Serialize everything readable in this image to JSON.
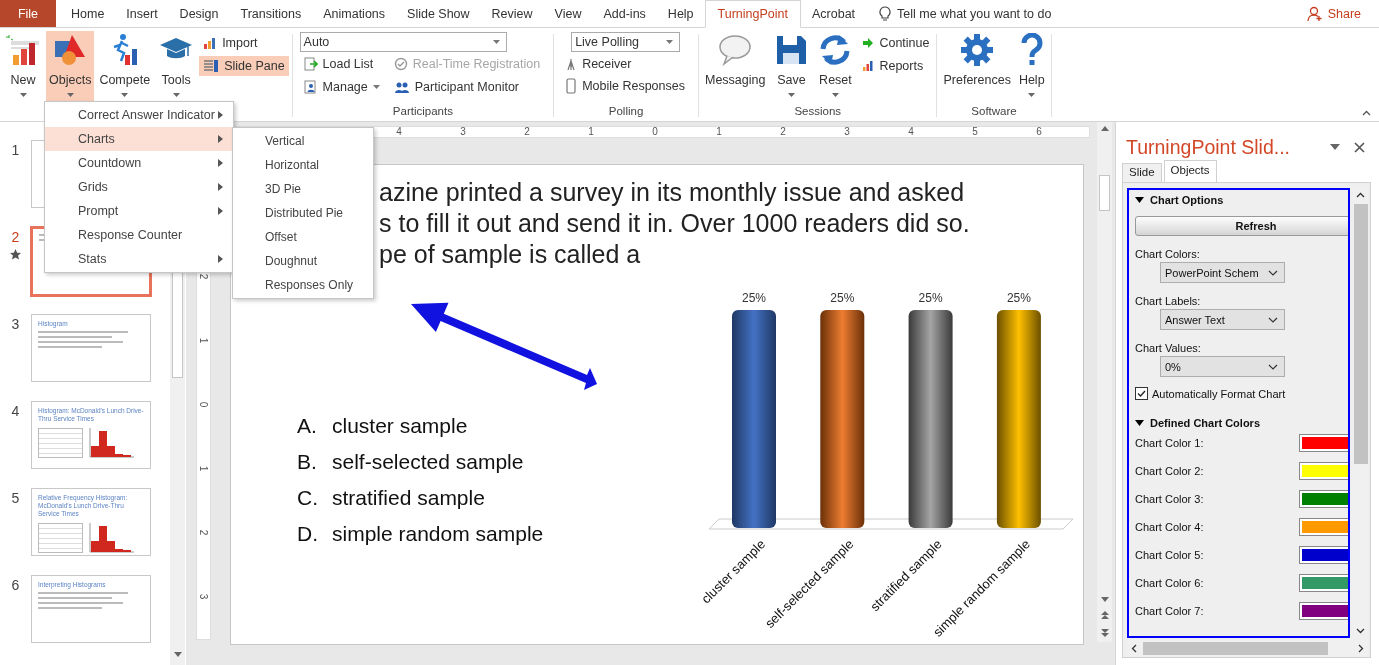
{
  "tabs": [
    {
      "label": "File",
      "kind": "file",
      "selected": false
    },
    {
      "label": "Home",
      "kind": "tab",
      "selected": false
    },
    {
      "label": "Insert",
      "kind": "tab",
      "selected": false
    },
    {
      "label": "Design",
      "kind": "tab",
      "selected": false
    },
    {
      "label": "Transitions",
      "kind": "tab",
      "selected": false
    },
    {
      "label": "Animations",
      "kind": "tab",
      "selected": false
    },
    {
      "label": "Slide Show",
      "kind": "tab",
      "selected": false
    },
    {
      "label": "Review",
      "kind": "tab",
      "selected": false
    },
    {
      "label": "View",
      "kind": "tab",
      "selected": false
    },
    {
      "label": "Add-ins",
      "kind": "tab",
      "selected": false
    },
    {
      "label": "Help",
      "kind": "tab",
      "selected": false
    },
    {
      "label": "TurningPoint",
      "kind": "tab",
      "selected": true
    },
    {
      "label": "Acrobat",
      "kind": "tab",
      "selected": false
    }
  ],
  "tell_me": "Tell me what you want to do",
  "share": "Share",
  "ribbon": {
    "insert_group": {
      "large": [
        {
          "label": "New",
          "caret": true,
          "highlighted": false
        },
        {
          "label": "Objects",
          "caret": true,
          "highlighted": true
        },
        {
          "label": "Compete",
          "caret": true,
          "highlighted": false
        },
        {
          "label": "Tools",
          "caret": true,
          "highlighted": false
        }
      ],
      "small": [
        {
          "label": "Import",
          "highlighted": false
        },
        {
          "label": "Slide Pane",
          "highlighted": true
        }
      ]
    },
    "participants": {
      "label": "Participants",
      "dropdown": "Auto",
      "items": [
        {
          "label": "Load List",
          "disabled": false
        },
        {
          "label": "Real-Time Registration",
          "disabled": true
        },
        {
          "label": "Manage",
          "disabled": false,
          "caret": true
        },
        {
          "label": "Participant Monitor",
          "disabled": false
        }
      ]
    },
    "polling": {
      "label": "Polling",
      "dropdown": "Live Polling",
      "items": [
        {
          "label": "Receiver"
        },
        {
          "label": "Mobile Responses"
        }
      ]
    },
    "sessions": {
      "label": "Sessions",
      "large": [
        {
          "label": "Messaging",
          "caret": false
        },
        {
          "label": "Save",
          "caret": true
        },
        {
          "label": "Reset",
          "caret": true
        }
      ],
      "small": [
        {
          "label": "Continue"
        },
        {
          "label": "Reports"
        }
      ]
    },
    "software": {
      "label": "Software",
      "large": [
        {
          "label": "Preferences",
          "caret": false
        },
        {
          "label": "Help",
          "caret": true
        }
      ]
    }
  },
  "objects_menu": [
    {
      "label": "Correct Answer Indicator",
      "submenu": true,
      "selected": false
    },
    {
      "label": "Charts",
      "submenu": true,
      "selected": true
    },
    {
      "label": "Countdown",
      "submenu": true,
      "selected": false
    },
    {
      "label": "Grids",
      "submenu": true,
      "selected": false
    },
    {
      "label": "Prompt",
      "submenu": true,
      "selected": false
    },
    {
      "label": "Response Counter",
      "submenu": false,
      "selected": false
    },
    {
      "label": "Stats",
      "submenu": true,
      "selected": false
    }
  ],
  "charts_submenu": [
    "Vertical",
    "Horizontal",
    "3D Pie",
    "Distributed Pie",
    "Offset",
    "Doughnut",
    "Responses Only"
  ],
  "slides": [
    {
      "number": "1",
      "kind": "blank",
      "selected": false,
      "starred": false
    },
    {
      "number": "2",
      "kind": "question",
      "selected": true,
      "starred": true
    },
    {
      "number": "3",
      "kind": "bullets",
      "selected": false,
      "starred": false,
      "title": "Histogram"
    },
    {
      "number": "4",
      "kind": "histogram",
      "selected": false,
      "starred": false,
      "title": "Histogram: McDonald's Lunch Drive-Thru Service Times"
    },
    {
      "number": "5",
      "kind": "histogram",
      "selected": false,
      "starred": false,
      "title": "Relative Frequency Histogram: McDonald's Lunch Drive-Thru Service Times"
    },
    {
      "number": "6",
      "kind": "bullets",
      "selected": false,
      "starred": false,
      "title": "Interpreting Histograms"
    }
  ],
  "ruler": {
    "horizontal": [
      "4",
      "3",
      "2",
      "1",
      "0",
      "1",
      "2",
      "3",
      "4",
      "5",
      "6"
    ],
    "vertical": [
      "2",
      "1",
      "0",
      "1",
      "2",
      "3"
    ]
  },
  "slide": {
    "question_lines": [
      "azine printed a survey in its monthly issue and asked",
      "s to fill it out and send it in. Over 1000 readers did so.",
      "pe of sample is called a"
    ],
    "answers": [
      {
        "letter": "A.",
        "text": "cluster sample"
      },
      {
        "letter": "B.",
        "text": "self-selected sample"
      },
      {
        "letter": "C.",
        "text": "stratified sample"
      },
      {
        "letter": "D.",
        "text": "simple random sample"
      }
    ],
    "chart_data": {
      "type": "bar",
      "categories": [
        "cluster sample",
        "self-selected sample",
        "stratified sample",
        "simple random sample"
      ],
      "values": [
        25,
        25,
        25,
        25
      ],
      "value_labels": [
        "25%",
        "25%",
        "25%",
        "25%"
      ]
    }
  },
  "task_pane": {
    "title": "TurningPoint Slid...",
    "tabs": [
      {
        "label": "Slide",
        "selected": false
      },
      {
        "label": "Objects",
        "selected": true
      }
    ],
    "chart_options": {
      "title": "Chart Options",
      "expanded": true,
      "refresh": "Refresh",
      "fields": [
        {
          "label": "Chart Colors:",
          "value": "PowerPoint Schem"
        },
        {
          "label": "Chart Labels:",
          "value": "Answer Text"
        },
        {
          "label": "Chart Values:",
          "value": "0%"
        }
      ],
      "auto_format": {
        "label": "Automatically Format Chart",
        "checked": true
      }
    },
    "defined_colors": {
      "title": "Defined Chart Colors",
      "expanded": true,
      "rows": [
        {
          "label": "Chart Color 1:",
          "color": "#ff0000"
        },
        {
          "label": "Chart Color 2:",
          "color": "#ffff00"
        },
        {
          "label": "Chart Color 3:",
          "color": "#008000"
        },
        {
          "label": "Chart Color 4:",
          "color": "#ff9900"
        },
        {
          "label": "Chart Color 5:",
          "color": "#0000cc"
        },
        {
          "label": "Chart Color 6:",
          "color": "#339966"
        },
        {
          "label": "Chart Color 7:",
          "color": "#800080"
        }
      ]
    }
  }
}
